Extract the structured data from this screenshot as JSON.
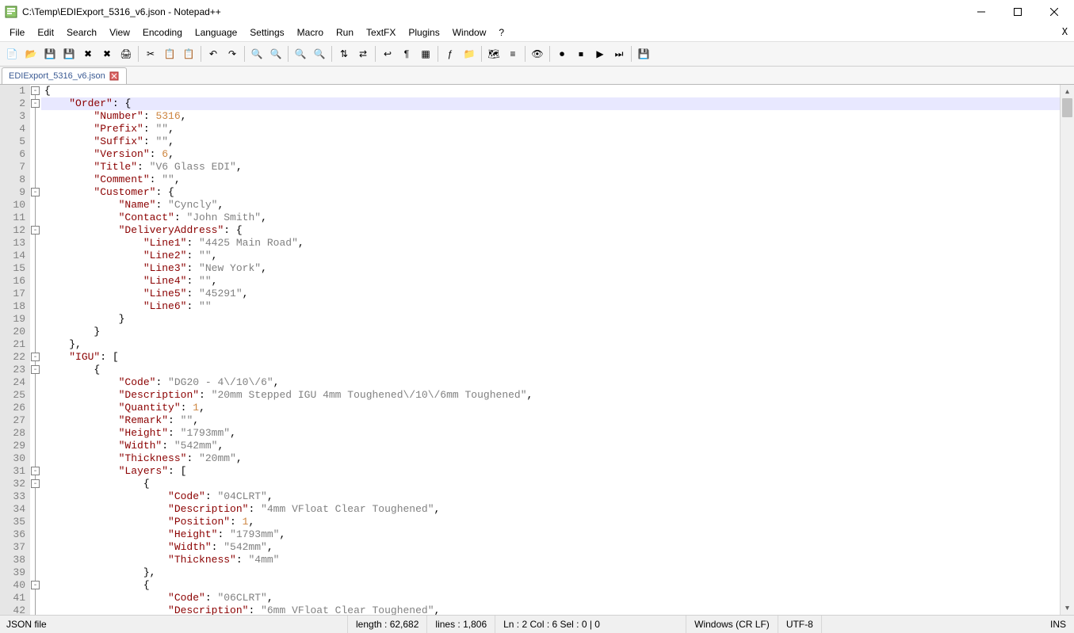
{
  "title": "C:\\Temp\\EDIExport_5316_v6.json - Notepad++",
  "menus": [
    "File",
    "Edit",
    "Search",
    "View",
    "Encoding",
    "Language",
    "Settings",
    "Macro",
    "Run",
    "TextFX",
    "Plugins",
    "Window",
    "?"
  ],
  "toolbar_icons": [
    "new",
    "open",
    "save",
    "save-all",
    "close",
    "close-all",
    "print",
    "sep",
    "cut",
    "copy",
    "paste",
    "sep",
    "undo",
    "redo",
    "sep",
    "find",
    "replace",
    "sep",
    "zoom-in",
    "zoom-out",
    "sep",
    "sync-v",
    "sync-h",
    "sep",
    "wrap",
    "all-chars",
    "indent-guide",
    "sep",
    "lang",
    "folder",
    "sep",
    "doc-map",
    "func-list",
    "sep",
    "monitor",
    "sep",
    "record",
    "stop",
    "play",
    "play-multi",
    "sep",
    "save-session"
  ],
  "tab": {
    "name": "EDIExport_5316_v6.json",
    "dirty": true
  },
  "highlight_line": 2,
  "fold_markers": [
    1,
    2,
    9,
    12,
    22,
    23,
    31,
    32,
    40
  ],
  "code": {
    "lines": [
      {
        "n": 1,
        "seg": [
          {
            "c": "b",
            "t": "{"
          }
        ]
      },
      {
        "n": 2,
        "seg": [
          {
            "c": "p",
            "t": "    "
          },
          {
            "c": "k",
            "t": "\"Order\""
          },
          {
            "c": "p",
            "t": ": "
          },
          {
            "c": "b",
            "t": "{"
          }
        ]
      },
      {
        "n": 3,
        "seg": [
          {
            "c": "p",
            "t": "        "
          },
          {
            "c": "k",
            "t": "\"Number\""
          },
          {
            "c": "p",
            "t": ": "
          },
          {
            "c": "n",
            "t": "5316"
          },
          {
            "c": "p",
            "t": ","
          }
        ]
      },
      {
        "n": 4,
        "seg": [
          {
            "c": "p",
            "t": "        "
          },
          {
            "c": "k",
            "t": "\"Prefix\""
          },
          {
            "c": "p",
            "t": ": "
          },
          {
            "c": "s",
            "t": "\"\""
          },
          {
            "c": "p",
            "t": ","
          }
        ]
      },
      {
        "n": 5,
        "seg": [
          {
            "c": "p",
            "t": "        "
          },
          {
            "c": "k",
            "t": "\"Suffix\""
          },
          {
            "c": "p",
            "t": ": "
          },
          {
            "c": "s",
            "t": "\"\""
          },
          {
            "c": "p",
            "t": ","
          }
        ]
      },
      {
        "n": 6,
        "seg": [
          {
            "c": "p",
            "t": "        "
          },
          {
            "c": "k",
            "t": "\"Version\""
          },
          {
            "c": "p",
            "t": ": "
          },
          {
            "c": "n",
            "t": "6"
          },
          {
            "c": "p",
            "t": ","
          }
        ]
      },
      {
        "n": 7,
        "seg": [
          {
            "c": "p",
            "t": "        "
          },
          {
            "c": "k",
            "t": "\"Title\""
          },
          {
            "c": "p",
            "t": ": "
          },
          {
            "c": "s",
            "t": "\"V6 Glass EDI\""
          },
          {
            "c": "p",
            "t": ","
          }
        ]
      },
      {
        "n": 8,
        "seg": [
          {
            "c": "p",
            "t": "        "
          },
          {
            "c": "k",
            "t": "\"Comment\""
          },
          {
            "c": "p",
            "t": ": "
          },
          {
            "c": "s",
            "t": "\"\""
          },
          {
            "c": "p",
            "t": ","
          }
        ]
      },
      {
        "n": 9,
        "seg": [
          {
            "c": "p",
            "t": "        "
          },
          {
            "c": "k",
            "t": "\"Customer\""
          },
          {
            "c": "p",
            "t": ": "
          },
          {
            "c": "b",
            "t": "{"
          }
        ]
      },
      {
        "n": 10,
        "seg": [
          {
            "c": "p",
            "t": "            "
          },
          {
            "c": "k",
            "t": "\"Name\""
          },
          {
            "c": "p",
            "t": ": "
          },
          {
            "c": "s",
            "t": "\"Cyncly\""
          },
          {
            "c": "p",
            "t": ","
          }
        ]
      },
      {
        "n": 11,
        "seg": [
          {
            "c": "p",
            "t": "            "
          },
          {
            "c": "k",
            "t": "\"Contact\""
          },
          {
            "c": "p",
            "t": ": "
          },
          {
            "c": "s",
            "t": "\"John Smith\""
          },
          {
            "c": "p",
            "t": ","
          }
        ]
      },
      {
        "n": 12,
        "seg": [
          {
            "c": "p",
            "t": "            "
          },
          {
            "c": "k",
            "t": "\"DeliveryAddress\""
          },
          {
            "c": "p",
            "t": ": "
          },
          {
            "c": "b",
            "t": "{"
          }
        ]
      },
      {
        "n": 13,
        "seg": [
          {
            "c": "p",
            "t": "                "
          },
          {
            "c": "k",
            "t": "\"Line1\""
          },
          {
            "c": "p",
            "t": ": "
          },
          {
            "c": "s",
            "t": "\"4425 Main Road\""
          },
          {
            "c": "p",
            "t": ","
          }
        ]
      },
      {
        "n": 14,
        "seg": [
          {
            "c": "p",
            "t": "                "
          },
          {
            "c": "k",
            "t": "\"Line2\""
          },
          {
            "c": "p",
            "t": ": "
          },
          {
            "c": "s",
            "t": "\"\""
          },
          {
            "c": "p",
            "t": ","
          }
        ]
      },
      {
        "n": 15,
        "seg": [
          {
            "c": "p",
            "t": "                "
          },
          {
            "c": "k",
            "t": "\"Line3\""
          },
          {
            "c": "p",
            "t": ": "
          },
          {
            "c": "s",
            "t": "\"New York\""
          },
          {
            "c": "p",
            "t": ","
          }
        ]
      },
      {
        "n": 16,
        "seg": [
          {
            "c": "p",
            "t": "                "
          },
          {
            "c": "k",
            "t": "\"Line4\""
          },
          {
            "c": "p",
            "t": ": "
          },
          {
            "c": "s",
            "t": "\"\""
          },
          {
            "c": "p",
            "t": ","
          }
        ]
      },
      {
        "n": 17,
        "seg": [
          {
            "c": "p",
            "t": "                "
          },
          {
            "c": "k",
            "t": "\"Line5\""
          },
          {
            "c": "p",
            "t": ": "
          },
          {
            "c": "s",
            "t": "\"45291\""
          },
          {
            "c": "p",
            "t": ","
          }
        ]
      },
      {
        "n": 18,
        "seg": [
          {
            "c": "p",
            "t": "                "
          },
          {
            "c": "k",
            "t": "\"Line6\""
          },
          {
            "c": "p",
            "t": ": "
          },
          {
            "c": "s",
            "t": "\"\""
          }
        ]
      },
      {
        "n": 19,
        "seg": [
          {
            "c": "p",
            "t": "            "
          },
          {
            "c": "b",
            "t": "}"
          }
        ]
      },
      {
        "n": 20,
        "seg": [
          {
            "c": "p",
            "t": "        "
          },
          {
            "c": "b",
            "t": "}"
          }
        ]
      },
      {
        "n": 21,
        "seg": [
          {
            "c": "p",
            "t": "    "
          },
          {
            "c": "b",
            "t": "}"
          },
          {
            "c": "p",
            "t": ","
          }
        ]
      },
      {
        "n": 22,
        "seg": [
          {
            "c": "p",
            "t": "    "
          },
          {
            "c": "k",
            "t": "\"IGU\""
          },
          {
            "c": "p",
            "t": ": "
          },
          {
            "c": "b",
            "t": "["
          }
        ]
      },
      {
        "n": 23,
        "seg": [
          {
            "c": "p",
            "t": "        "
          },
          {
            "c": "b",
            "t": "{"
          }
        ]
      },
      {
        "n": 24,
        "seg": [
          {
            "c": "p",
            "t": "            "
          },
          {
            "c": "k",
            "t": "\"Code\""
          },
          {
            "c": "p",
            "t": ": "
          },
          {
            "c": "s",
            "t": "\"DG20 - 4\\/10\\/6\""
          },
          {
            "c": "p",
            "t": ","
          }
        ]
      },
      {
        "n": 25,
        "seg": [
          {
            "c": "p",
            "t": "            "
          },
          {
            "c": "k",
            "t": "\"Description\""
          },
          {
            "c": "p",
            "t": ": "
          },
          {
            "c": "s",
            "t": "\"20mm Stepped IGU 4mm Toughened\\/10\\/6mm Toughened\""
          },
          {
            "c": "p",
            "t": ","
          }
        ]
      },
      {
        "n": 26,
        "seg": [
          {
            "c": "p",
            "t": "            "
          },
          {
            "c": "k",
            "t": "\"Quantity\""
          },
          {
            "c": "p",
            "t": ": "
          },
          {
            "c": "n",
            "t": "1"
          },
          {
            "c": "p",
            "t": ","
          }
        ]
      },
      {
        "n": 27,
        "seg": [
          {
            "c": "p",
            "t": "            "
          },
          {
            "c": "k",
            "t": "\"Remark\""
          },
          {
            "c": "p",
            "t": ": "
          },
          {
            "c": "s",
            "t": "\"\""
          },
          {
            "c": "p",
            "t": ","
          }
        ]
      },
      {
        "n": 28,
        "seg": [
          {
            "c": "p",
            "t": "            "
          },
          {
            "c": "k",
            "t": "\"Height\""
          },
          {
            "c": "p",
            "t": ": "
          },
          {
            "c": "s",
            "t": "\"1793mm\""
          },
          {
            "c": "p",
            "t": ","
          }
        ]
      },
      {
        "n": 29,
        "seg": [
          {
            "c": "p",
            "t": "            "
          },
          {
            "c": "k",
            "t": "\"Width\""
          },
          {
            "c": "p",
            "t": ": "
          },
          {
            "c": "s",
            "t": "\"542mm\""
          },
          {
            "c": "p",
            "t": ","
          }
        ]
      },
      {
        "n": 30,
        "seg": [
          {
            "c": "p",
            "t": "            "
          },
          {
            "c": "k",
            "t": "\"Thickness\""
          },
          {
            "c": "p",
            "t": ": "
          },
          {
            "c": "s",
            "t": "\"20mm\""
          },
          {
            "c": "p",
            "t": ","
          }
        ]
      },
      {
        "n": 31,
        "seg": [
          {
            "c": "p",
            "t": "            "
          },
          {
            "c": "k",
            "t": "\"Layers\""
          },
          {
            "c": "p",
            "t": ": "
          },
          {
            "c": "b",
            "t": "["
          }
        ]
      },
      {
        "n": 32,
        "seg": [
          {
            "c": "p",
            "t": "                "
          },
          {
            "c": "b",
            "t": "{"
          }
        ]
      },
      {
        "n": 33,
        "seg": [
          {
            "c": "p",
            "t": "                    "
          },
          {
            "c": "k",
            "t": "\"Code\""
          },
          {
            "c": "p",
            "t": ": "
          },
          {
            "c": "s",
            "t": "\"04CLRT\""
          },
          {
            "c": "p",
            "t": ","
          }
        ]
      },
      {
        "n": 34,
        "seg": [
          {
            "c": "p",
            "t": "                    "
          },
          {
            "c": "k",
            "t": "\"Description\""
          },
          {
            "c": "p",
            "t": ": "
          },
          {
            "c": "s",
            "t": "\"4mm VFloat Clear Toughened\""
          },
          {
            "c": "p",
            "t": ","
          }
        ]
      },
      {
        "n": 35,
        "seg": [
          {
            "c": "p",
            "t": "                    "
          },
          {
            "c": "k",
            "t": "\"Position\""
          },
          {
            "c": "p",
            "t": ": "
          },
          {
            "c": "n",
            "t": "1"
          },
          {
            "c": "p",
            "t": ","
          }
        ]
      },
      {
        "n": 36,
        "seg": [
          {
            "c": "p",
            "t": "                    "
          },
          {
            "c": "k",
            "t": "\"Height\""
          },
          {
            "c": "p",
            "t": ": "
          },
          {
            "c": "s",
            "t": "\"1793mm\""
          },
          {
            "c": "p",
            "t": ","
          }
        ]
      },
      {
        "n": 37,
        "seg": [
          {
            "c": "p",
            "t": "                    "
          },
          {
            "c": "k",
            "t": "\"Width\""
          },
          {
            "c": "p",
            "t": ": "
          },
          {
            "c": "s",
            "t": "\"542mm\""
          },
          {
            "c": "p",
            "t": ","
          }
        ]
      },
      {
        "n": 38,
        "seg": [
          {
            "c": "p",
            "t": "                    "
          },
          {
            "c": "k",
            "t": "\"Thickness\""
          },
          {
            "c": "p",
            "t": ": "
          },
          {
            "c": "s",
            "t": "\"4mm\""
          }
        ]
      },
      {
        "n": 39,
        "seg": [
          {
            "c": "p",
            "t": "                "
          },
          {
            "c": "b",
            "t": "}"
          },
          {
            "c": "p",
            "t": ","
          }
        ]
      },
      {
        "n": 40,
        "seg": [
          {
            "c": "p",
            "t": "                "
          },
          {
            "c": "b",
            "t": "{"
          }
        ]
      },
      {
        "n": 41,
        "seg": [
          {
            "c": "p",
            "t": "                    "
          },
          {
            "c": "k",
            "t": "\"Code\""
          },
          {
            "c": "p",
            "t": ": "
          },
          {
            "c": "s",
            "t": "\"06CLRT\""
          },
          {
            "c": "p",
            "t": ","
          }
        ]
      },
      {
        "n": 42,
        "seg": [
          {
            "c": "p",
            "t": "                    "
          },
          {
            "c": "k",
            "t": "\"Description\""
          },
          {
            "c": "p",
            "t": ": "
          },
          {
            "c": "s",
            "t": "\"6mm VFloat Clear Toughened\""
          },
          {
            "c": "p",
            "t": ","
          }
        ]
      }
    ]
  },
  "status": {
    "lang": "JSON file",
    "length": "length : 62,682",
    "lines": "lines : 1,806",
    "pos": "Ln : 2    Col : 6    Sel : 0 | 0",
    "eol": "Windows (CR LF)",
    "encoding": "UTF-8",
    "mode": "INS"
  },
  "icons": {
    "new": "📄",
    "open": "📂",
    "save": "💾",
    "save-all": "💾",
    "close": "✖",
    "close-all": "✖",
    "print": "🖨",
    "cut": "✂",
    "copy": "📋",
    "paste": "📋",
    "undo": "↶",
    "redo": "↷",
    "find": "🔍",
    "replace": "🔍",
    "zoom-in": "🔍",
    "zoom-out": "🔍",
    "sync-v": "⇅",
    "sync-h": "⇄",
    "wrap": "↩",
    "all-chars": "¶",
    "indent-guide": "▦",
    "lang": "ƒ",
    "folder": "📁",
    "doc-map": "🗺",
    "func-list": "≡",
    "monitor": "👁",
    "record": "⏺",
    "stop": "⏹",
    "play": "▶",
    "play-multi": "⏭",
    "save-session": "💾"
  }
}
